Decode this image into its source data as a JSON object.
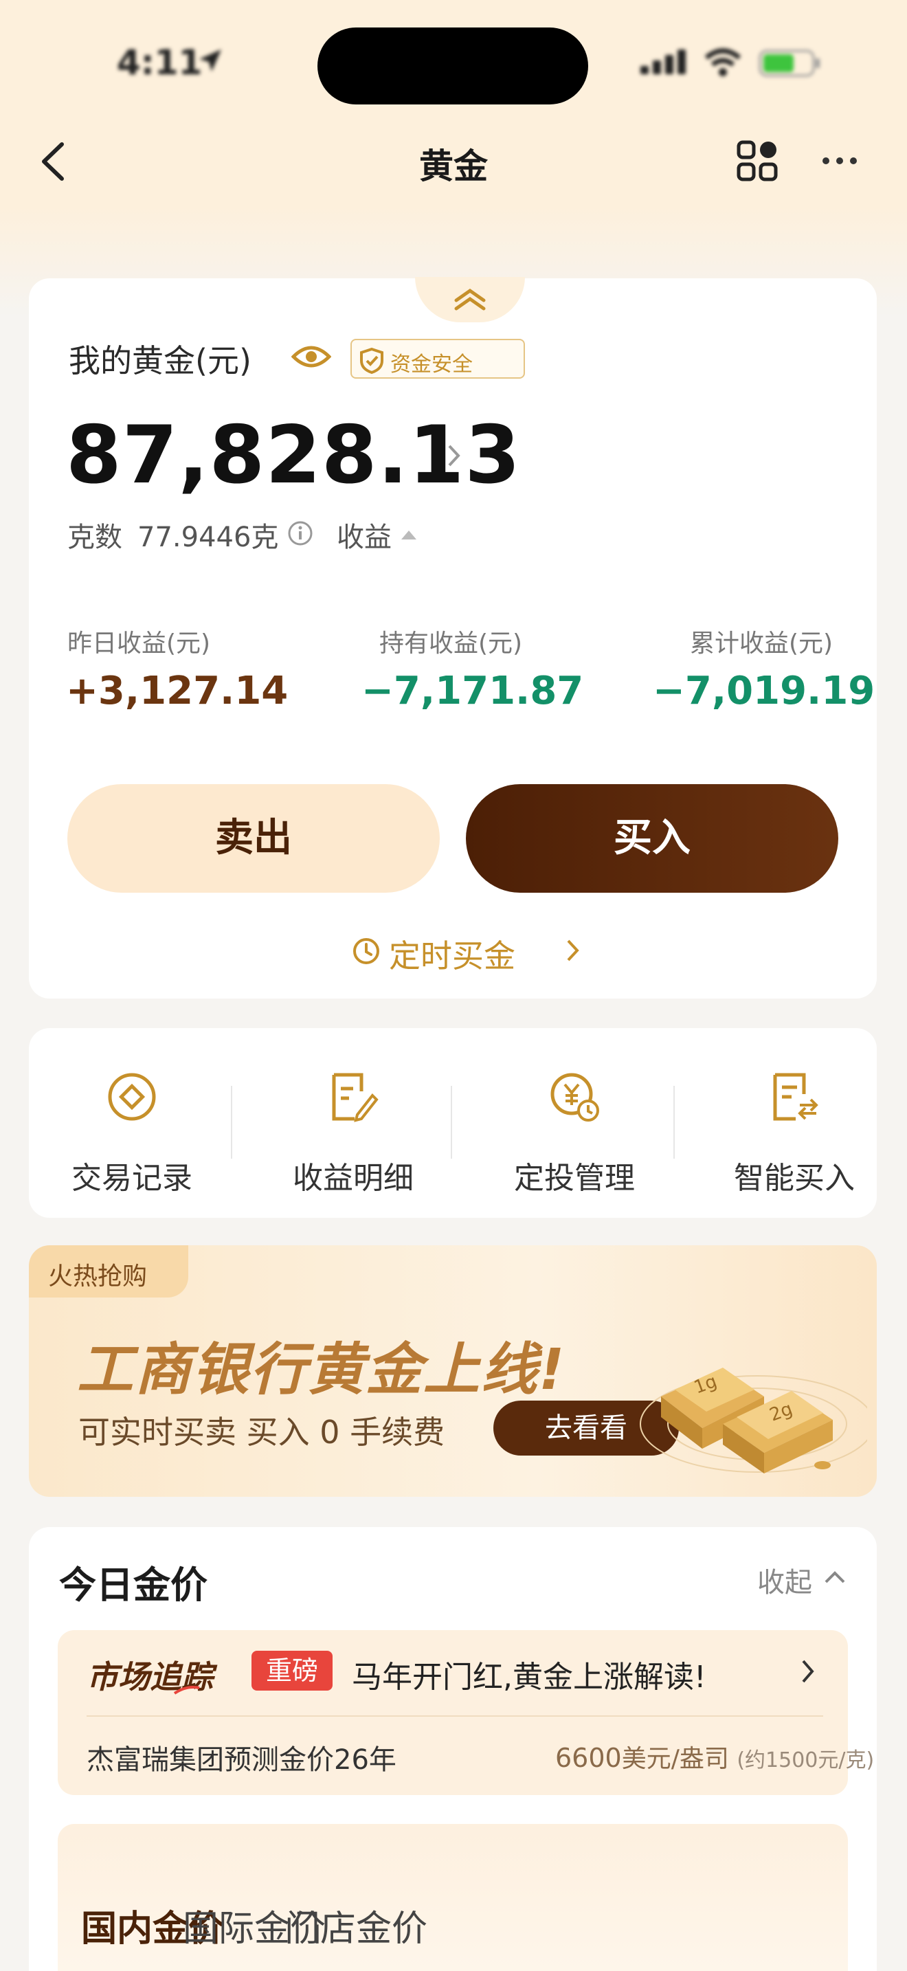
{
  "status_bar": {
    "time": "4:11"
  },
  "nav": {
    "title": "黄金"
  },
  "holdings": {
    "label": "我的黄金(元)",
    "safe_badge": "资金安全",
    "amount": "87,828.13",
    "grams_label": "克数",
    "grams_value": "77.9446克",
    "earnings_toggle": "收益"
  },
  "stats": [
    {
      "label": "昨日收益(元)",
      "value": "+3,127.14",
      "trend": "up"
    },
    {
      "label": "持有收益(元)",
      "value": "−7,171.87",
      "trend": "down"
    },
    {
      "label": "累计收益(元)",
      "value": "−7,019.19",
      "trend": "down"
    }
  ],
  "actions": {
    "sell": "卖出",
    "buy": "买入",
    "schedule": "定时买金"
  },
  "functions": [
    {
      "label": "交易记录",
      "icon": "transaction-record-icon"
    },
    {
      "label": "收益明细",
      "icon": "earnings-detail-icon"
    },
    {
      "label": "定投管理",
      "icon": "auto-invest-icon"
    },
    {
      "label": "智能买入",
      "icon": "smart-buy-icon"
    }
  ],
  "banner": {
    "tag": "火热抢购",
    "title": "工商银行黄金上线!",
    "subtitle": "可实时买卖 买入 0 手续费",
    "button": "去看看",
    "bar_labels": [
      "1g",
      "2g"
    ]
  },
  "price_section": {
    "title": "今日金价",
    "collapse": "收起",
    "news_brand": "市场追踪",
    "news_tag": "重磅",
    "news_headline": "马年开门红,黄金上涨解读!",
    "news_sub": "杰富瑞集团预测金价26年",
    "forecast_value": "6600",
    "forecast_unit": "美元/盎司",
    "forecast_note": "(约1500元/克)",
    "tabs": [
      "国内金价",
      "国际金价",
      "门店金价"
    ]
  },
  "colors": {
    "accent": "#c6902a",
    "positive": "#6b3510",
    "negative": "#139068",
    "buy_button": "#5a2a0c",
    "header_bg": "#fdf0dc"
  }
}
